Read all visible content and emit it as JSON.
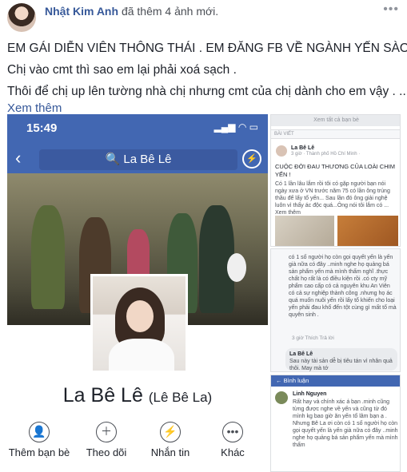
{
  "post": {
    "author": "Nhật Kim Anh",
    "action": "đã thêm 4 ảnh mới.",
    "more": "•••",
    "lines": [
      "EM GÁI DIỄN VIÊN THÔNG THÁI . EM ĐĂNG FB VỀ NGÀNH YẾN SÀO .",
      "Chị vào cmt thì sao em lại phải xoá sạch .",
      "Thôi để chị up lên tường nhà chị nhưng cmt của chị dành cho em vậy . ..."
    ],
    "see_more": "Xem thêm"
  },
  "phone": {
    "time": "15:49",
    "status": "▂▄▆ ◠ ▭",
    "back": "‹",
    "search_text": "🔍 La Bê Lê",
    "messenger": "⚡",
    "profile_name": "La Bê Lê",
    "profile_alt": "(Lê Bê La)",
    "actions": [
      {
        "icon": "👤",
        "label": "Thêm bạn bè"
      },
      {
        "icon": "＋",
        "label": "Theo dõi"
      },
      {
        "icon": "⚡",
        "label": "Nhắn tin"
      },
      {
        "icon": "•••",
        "label": "Khác"
      }
    ]
  },
  "thumb1": {
    "bar": "Xem tất cả bạn bè",
    "sub": "BÀI VIẾT",
    "name": "La Bê Lê",
    "meta": "3 giờ · Thành phố Hồ Chí Minh ·",
    "title": "CUỘC ĐỜI ĐAU THƯƠNG CỦA LOÀI CHIM YẾN !",
    "body": "Có 1 lần lâu lắm rồi tôi có gặp người bạn nói ngày xưa ở VN trước năm 75 có lần ông trúng thầu để lấy tổ yến... Sau lần đó ông giải nghệ luôn vì thấy ác độc quá...Ông nói tôi lắm có ... Xem thêm"
  },
  "thumb2": {
    "comment": "có 1 số người họ còn gọi quyết yến là yến già nữa có đây ..minh nghe họ quảng bá sản phẩm yến mà mình thấm nghĩ .thực chất họ rất là có điều kiện rồi .có cty mỹ phẩm cao cấp có cả nguyên khu An Viên có cả sự nghiệp thành công .nhưng họ ác quá muốn nuôi yến rồi lấy tổ khiến cho loại yến phải đau khổ đến tột cùng gì mất tổ mà quyên sinh .",
    "meta": "3 giờ   Thích   Trả lời",
    "reply_name": "La Bê Lê",
    "reply": "Sau này tài sản dễ bị tiêu tán vì nhân quả thôi. May mà tớ"
  },
  "thumb3": {
    "bar": "←  Bình luận",
    "name": "Linh Nguyen",
    "comment": "Rất hay và chính xác á bạn .minh cũng từng được nghe về yến và cũng từ đó mình kg bao giờ ăn yến tổ lâm bạn ạ . Nhưng Bê La ơi còn có 1 số người họ còn gọi quyết yến là yến già nữa có đây ..minh nghe họ quảng bá sản phẩm yến mà mình thấm"
  }
}
